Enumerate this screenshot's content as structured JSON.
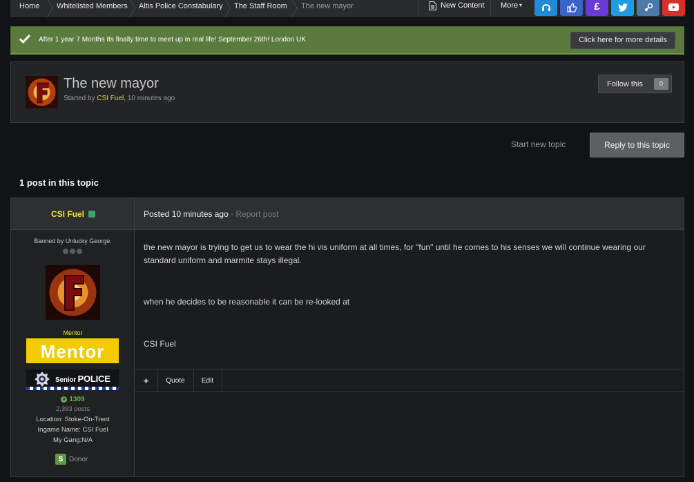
{
  "breadcrumb": {
    "items": [
      "Home",
      "Whitelisted Members",
      "Altis Police Constabulary",
      "The Staff Room",
      "The new mayor"
    ]
  },
  "nav": {
    "new_content": "New Content",
    "more": "More",
    "social": [
      {
        "name": "teamspeak",
        "color": "#1e8bd6"
      },
      {
        "name": "facebook-like",
        "color": "#3a64c9"
      },
      {
        "name": "donate-pound",
        "color": "#6a3ad6"
      },
      {
        "name": "twitter",
        "color": "#1d9be3"
      },
      {
        "name": "steam",
        "color": "#4c7aa8"
      },
      {
        "name": "youtube",
        "color": "#d6302a"
      }
    ]
  },
  "announcement": {
    "text": "After 1 year 7 Months Its finally time to meet up in real life! September 26th! London UK",
    "button": "Click here for more details"
  },
  "topic": {
    "title": "The new mayor",
    "started_by_prefix": "Started by ",
    "author": "CSI Fuel",
    "time": ", 10 minutes ago",
    "follow_label": "Follow this",
    "follow_count": "0"
  },
  "actions": {
    "start_new_topic": "Start new topic",
    "reply": "Reply to this topic"
  },
  "post_count": "1 post in this topic",
  "post": {
    "author": "CSI Fuel",
    "posted": "Posted 10 minutes ago",
    "separator": "·",
    "report": "Report post",
    "banned_by": "Banned by Unlucky George.",
    "rank": "Mentor",
    "mentor_banner": "Mentor",
    "police_badge_prefix": "Senior ",
    "police_badge_word": "POLICE",
    "reputation": "1309",
    "posts": "2,393 posts",
    "location": "Location: Stoke-On-Trent",
    "ingame_name": "Ingame Name: CSI Fuel",
    "gang": "My Gang:N/A",
    "donor": "Donor",
    "body": [
      "the new mayor is trying to get us to wear the hi vis uniform at all times, for \"fun\" until he comes to his senses we will continue wearing our standard uniform and marmite stays illegal.",
      "when he decides to be reasonable it can be re-looked at",
      "CSI Fuel"
    ],
    "controls": {
      "add": "+",
      "quote": "Quote",
      "edit": "Edit"
    }
  }
}
